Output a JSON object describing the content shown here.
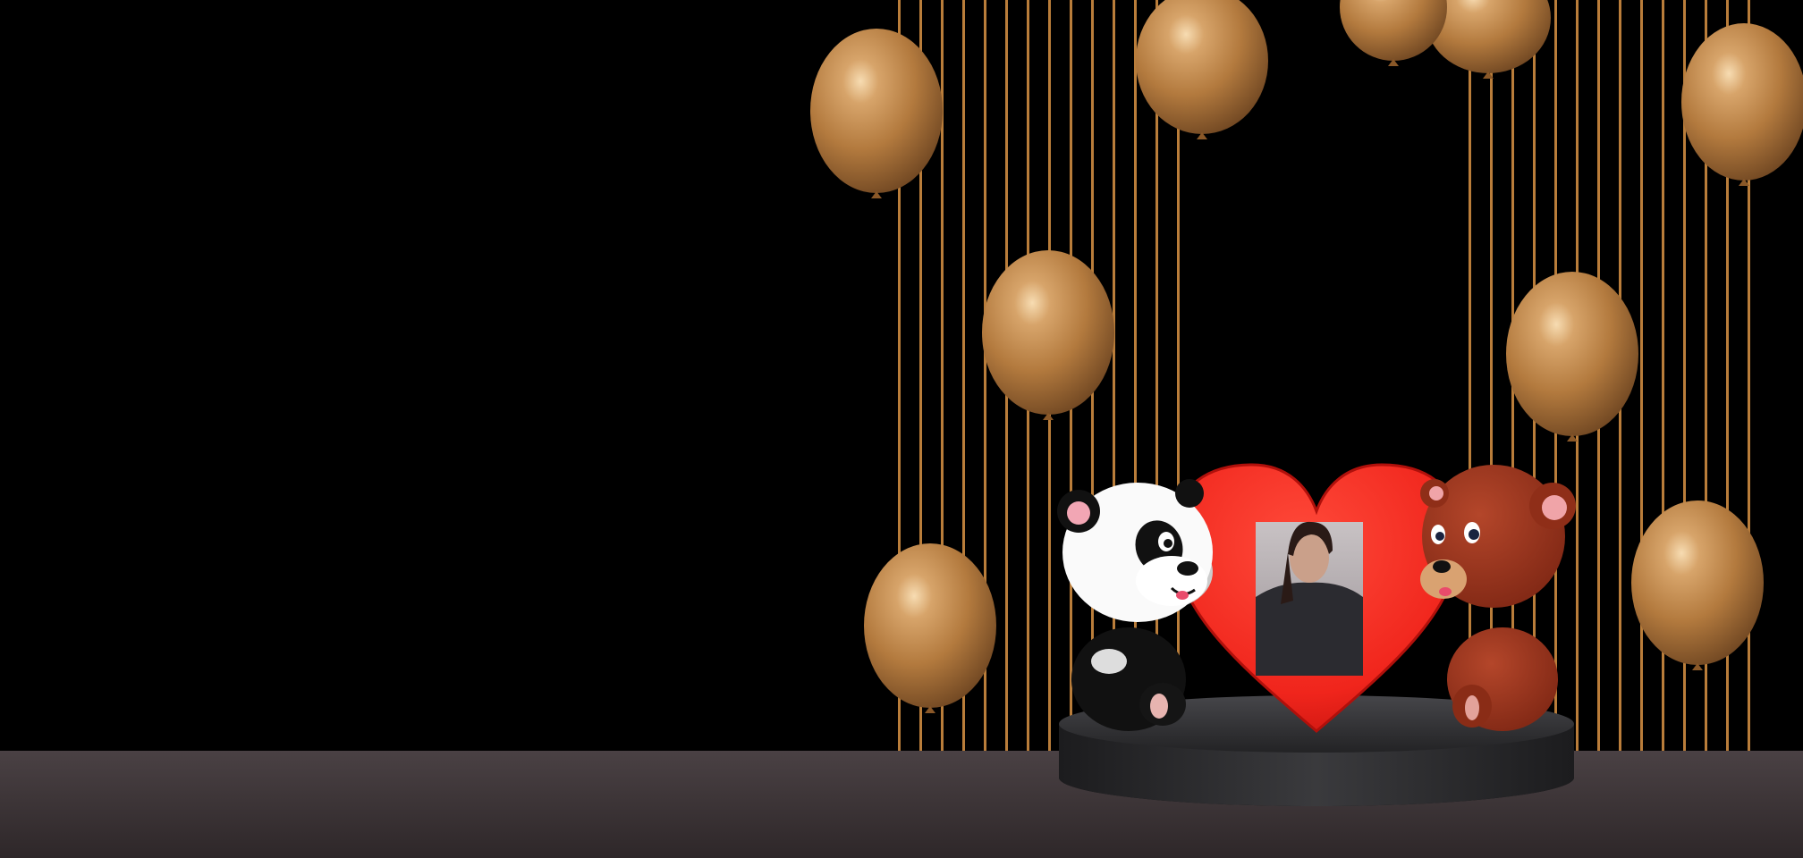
{
  "scene": {
    "background_color": "#000000",
    "floor_color": "#3b3436",
    "accent_gold": "#c8904a",
    "stripe_color": "#b97d3a",
    "balloon_color": "#b98244",
    "heart_color": "#f0251c",
    "pedestal_color": "#2c2c2e"
  },
  "elements": {
    "balloons": {
      "count": 9
    },
    "heart": {
      "contains": "portrait-photo"
    },
    "characters": [
      "panda-cartoon",
      "brown-bear-cartoon"
    ]
  }
}
